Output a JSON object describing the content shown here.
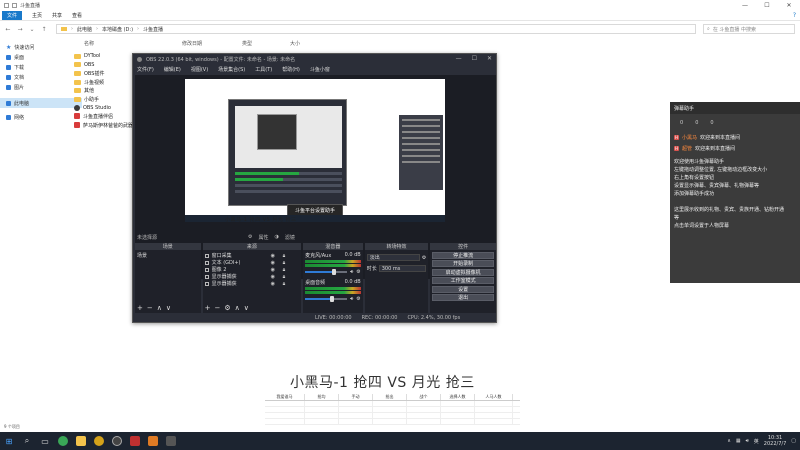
{
  "explorer": {
    "window_title": "斗鱼直播",
    "ribbon_tabs": [
      "文件",
      "主页",
      "共享",
      "查看"
    ],
    "address": {
      "parts": [
        "此电脑",
        "本地磁盘 (D:)",
        "斗鱼直播"
      ]
    },
    "search": {
      "placeholder": "在 斗鱼直播 中搜索"
    },
    "columns": [
      "名称",
      "修改日期",
      "类型",
      "大小"
    ],
    "nav": [
      {
        "label": "快速访问"
      },
      {
        "label": "桌面"
      },
      {
        "label": "下载"
      },
      {
        "label": "文档"
      },
      {
        "label": "图片"
      },
      {
        "label": "此电脑"
      },
      {
        "label": "网络"
      }
    ],
    "files": [
      {
        "name": "DYTool",
        "type": "folder"
      },
      {
        "name": "OBS",
        "type": "folder"
      },
      {
        "name": "OBS插件",
        "type": "folder"
      },
      {
        "name": "斗鱼视频",
        "type": "folder"
      },
      {
        "name": "其他",
        "type": "folder"
      },
      {
        "name": "小助手",
        "type": "folder"
      },
      {
        "name": "OBS Studio",
        "type": "app"
      },
      {
        "name": "斗鱼直播伴侣",
        "type": "red"
      },
      {
        "name": "萨马斯伊林爸爸的武器",
        "type": "red"
      }
    ],
    "item_count": "9 个项目"
  },
  "obs": {
    "window_title": "OBS 22.0.3 (64 bit, windows) - 配置文件: 未命名 - 场景: 未命名",
    "menu": [
      "文件(F)",
      "编辑(E)",
      "视图(V)",
      "场景集合(S)",
      "工具(T)",
      "帮助(H)",
      "斗鱼小窗"
    ],
    "preview": {
      "tooltip": "斗鱼平台设置助手",
      "caption": "小黑马-1 抢四 VS 月光 抢三"
    },
    "status_top": {
      "label": "未选择源",
      "items": [
        "属性",
        "滤镜"
      ]
    },
    "docks": {
      "scenes": {
        "title": "场景",
        "items": [
          "场景"
        ]
      },
      "sources": {
        "title": "来源",
        "items": [
          "窗口采集",
          "文本 (GDI+)",
          "图像 2",
          "显示器捕获",
          "显示器捕获"
        ]
      },
      "mixer": {
        "title": "混音器",
        "channels": [
          {
            "name": "麦克风/Aux",
            "db": "0.0 dB",
            "level": 0.7
          },
          {
            "name": "桌面音频",
            "db": "0.0 dB",
            "level": 0.65
          }
        ]
      },
      "transitions": {
        "title": "转场特效",
        "type": "淡出",
        "duration_label": "时长",
        "duration": "300 ms"
      },
      "controls": {
        "title": "控件",
        "buttons": [
          "停止推流",
          "开始录制",
          "启动虚拟摄像机",
          "工作室模式",
          "设置",
          "退出"
        ]
      }
    },
    "status_bar": {
      "live": "LIVE: 00:00:00",
      "rec": "REC: 00:00:00",
      "cpu": "CPU: 2.4%, 30.00 fps"
    }
  },
  "danmu": {
    "title": "弹幕助手",
    "stats": [
      "0",
      "0",
      "0"
    ],
    "messages": [
      {
        "badge": "H",
        "user": "小黑马",
        "text": "欢迎来到本直播间"
      },
      {
        "badge": "H",
        "user": "超管",
        "text": "欢迎来到本直播间"
      }
    ],
    "info": [
      "欢迎使用斗鱼弹幕助手",
      "左键拖动调整位置, 左键拖动边框改变大小",
      "右上角有设置按钮",
      "设置显示弹幕、贵宾弹幕、礼物弹幕等",
      "添加弹幕助手成功",
      "",
      "这里展示收到的礼物、贵宾、贵族开通、钻粉开通",
      "等",
      "点击单词设置于人物屏幕"
    ]
  },
  "bottom": {
    "vs_text": "小黑马-1 抢四 VS 月光 抢三",
    "sheet_headers": [
      "我爱谁马",
      "抢均",
      "手动",
      "抢出",
      "战个",
      "选择人数",
      "人马人数"
    ]
  },
  "taskbar": {
    "time": "10:31",
    "date": "2022/7/7",
    "tray_lang": "英"
  }
}
